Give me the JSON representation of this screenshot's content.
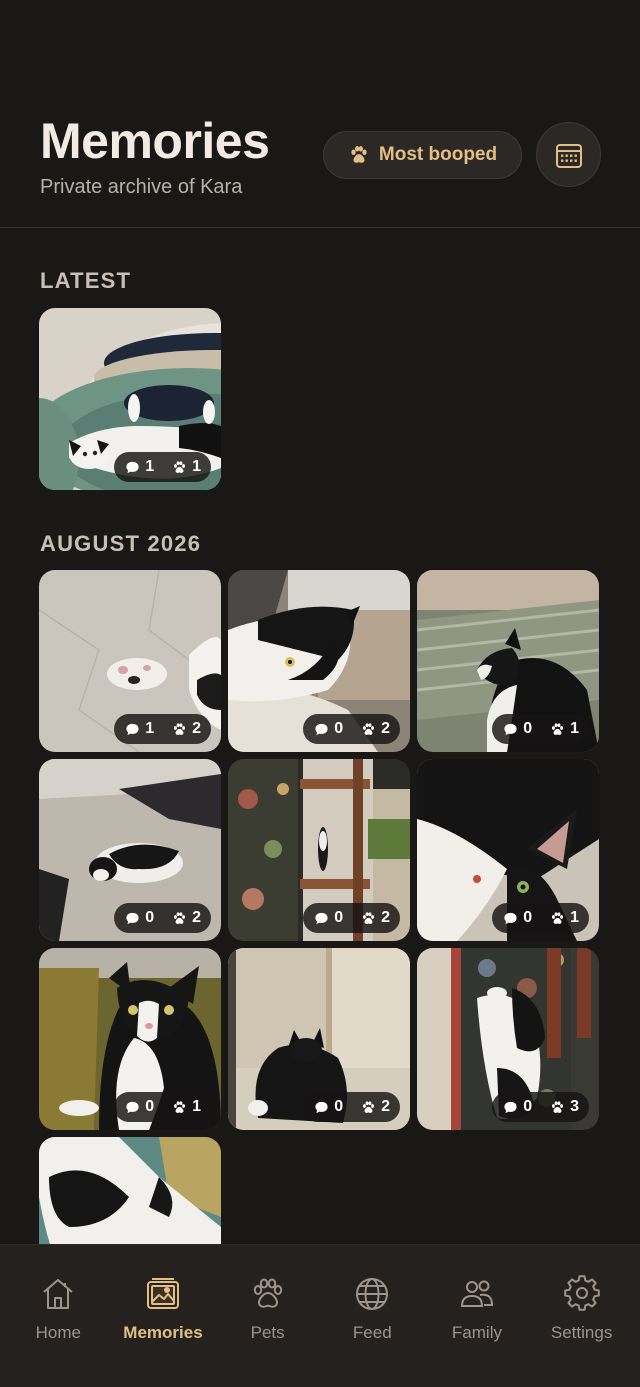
{
  "header": {
    "title": "Memories",
    "subtitle": "Private archive of Kara",
    "most_booped_label": "Most booped",
    "most_booped_icon": "paw-icon",
    "calendar_icon": "calendar-icon"
  },
  "sections": {
    "latest": {
      "title": "LATEST",
      "photos": [
        {
          "comments": "1",
          "boops": "1",
          "scene": "cat lying on round patterned rug"
        }
      ]
    },
    "august": {
      "title": "AUGUST 2026",
      "photos": [
        {
          "comments": "1",
          "boops": "2"
        },
        {
          "comments": "0",
          "boops": "2"
        },
        {
          "comments": "0",
          "boops": "1"
        },
        {
          "comments": "0",
          "boops": "2"
        },
        {
          "comments": "0",
          "boops": "2"
        },
        {
          "comments": "0",
          "boops": "1"
        },
        {
          "comments": "0",
          "boops": "1"
        },
        {
          "comments": "0",
          "boops": "2"
        },
        {
          "comments": "0",
          "boops": "3"
        },
        {
          "comments": "",
          "boops": ""
        }
      ]
    }
  },
  "tabs": [
    {
      "label": "Home",
      "icon": "home-icon",
      "active": false
    },
    {
      "label": "Memories",
      "icon": "photo-gallery-icon",
      "active": true
    },
    {
      "label": "Pets",
      "icon": "paw-icon",
      "active": false
    },
    {
      "label": "Feed",
      "icon": "globe-icon",
      "active": false
    },
    {
      "label": "Family",
      "icon": "people-icon",
      "active": false
    },
    {
      "label": "Settings",
      "icon": "gear-icon",
      "active": false
    }
  ],
  "colors": {
    "background": "#1a1817",
    "accent": "#e2bf84",
    "tab_inactive": "#9d958c"
  }
}
